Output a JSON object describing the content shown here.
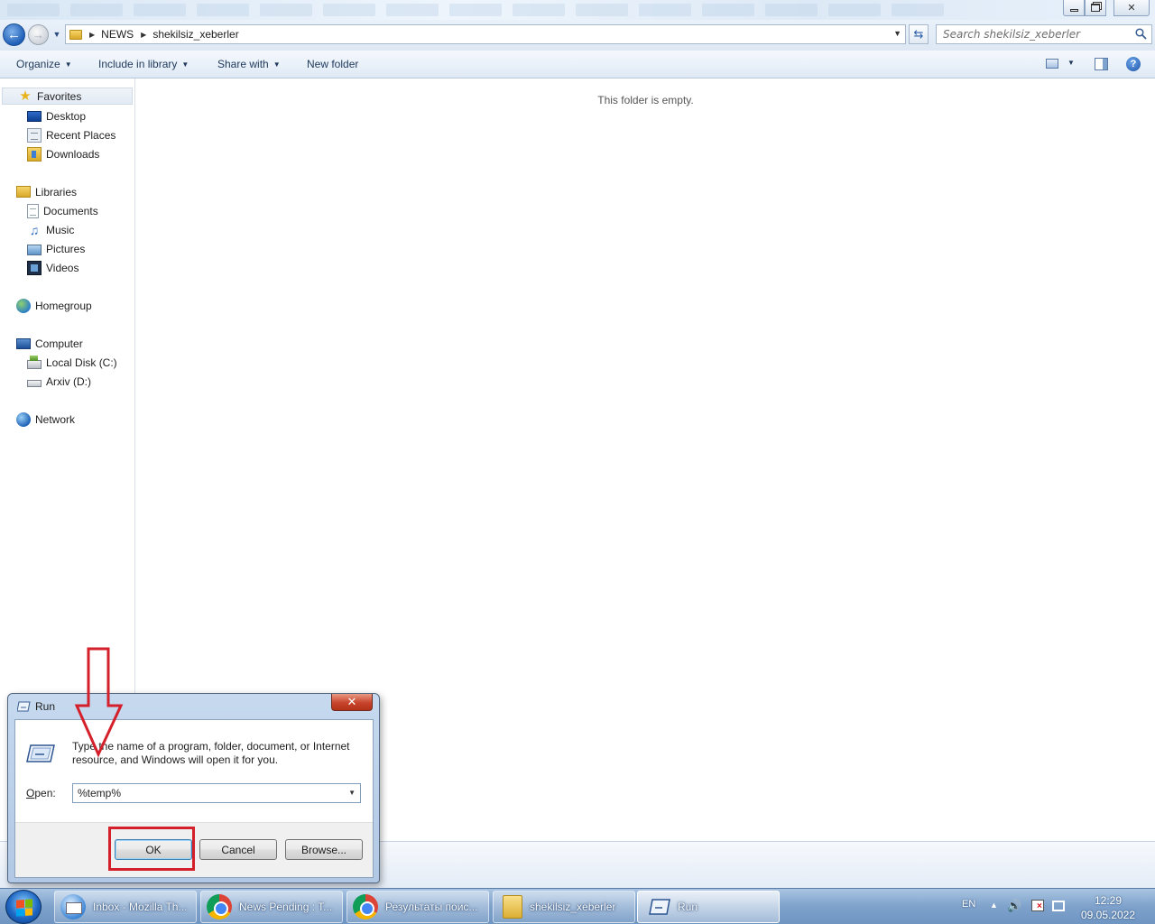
{
  "window": {
    "address": {
      "crumbs": [
        "NEWS",
        "shekilsiz_xeberler"
      ]
    },
    "search": {
      "placeholder": "Search shekilsiz_xeberler"
    },
    "toolbar": {
      "organize": "Organize",
      "include_in_library": "Include in library",
      "share_with": "Share with",
      "new_folder": "New folder"
    },
    "nav": {
      "favorites": "Favorites",
      "desktop": "Desktop",
      "recent_places": "Recent Places",
      "downloads": "Downloads",
      "libraries": "Libraries",
      "documents": "Documents",
      "music": "Music",
      "pictures": "Pictures",
      "videos": "Videos",
      "homegroup": "Homegroup",
      "computer": "Computer",
      "local_disk": "Local Disk (C:)",
      "arxiv": "Arxiv (D:)",
      "network": "Network"
    },
    "content": {
      "empty_message": "This folder is empty."
    }
  },
  "run_dialog": {
    "title": "Run",
    "description": "Type the name of a program, folder, document, or Internet resource, and Windows will open it for you.",
    "open_label_accel": "O",
    "open_label_rest": "pen:",
    "open_value": "%temp%",
    "ok_label": "OK",
    "cancel_label": "Cancel",
    "browse_label": "Browse..."
  },
  "taskbar": {
    "items": [
      {
        "label": "Inbox - Mozilla Th...",
        "icon": "thunderbird-icon"
      },
      {
        "label": "News Pending : T...",
        "icon": "chrome-icon"
      },
      {
        "label": "Результаты поис...",
        "icon": "chrome-icon"
      },
      {
        "label": "shekilsiz_xeberler",
        "icon": "folder-icon"
      },
      {
        "label": "Run",
        "icon": "run-icon"
      }
    ],
    "tray": {
      "language": "EN",
      "time": "12:29",
      "date": "09.05.2022"
    }
  },
  "colors": {
    "highlight_red": "#d4202a",
    "accent_blue": "#1f5fb7"
  }
}
